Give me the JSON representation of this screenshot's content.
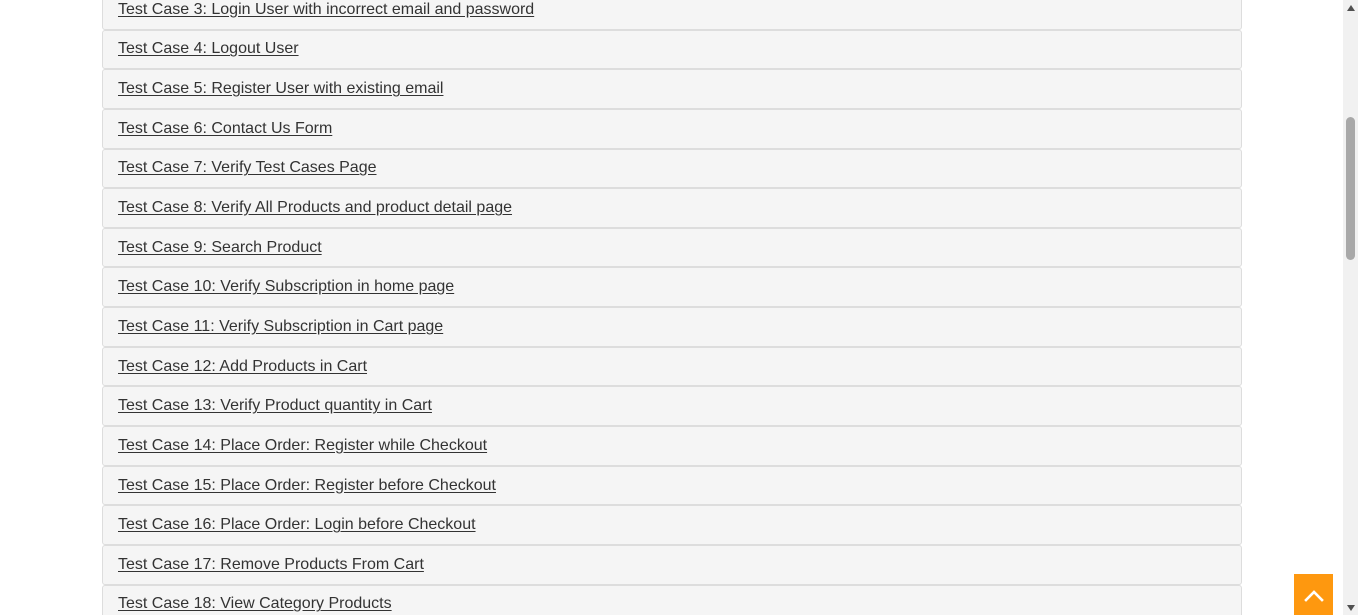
{
  "test_cases": [
    "Test Case 3: Login User with incorrect email and password",
    "Test Case 4: Logout User",
    "Test Case 5: Register User with existing email",
    "Test Case 6: Contact Us Form",
    "Test Case 7: Verify Test Cases Page",
    "Test Case 8: Verify All Products and product detail page",
    "Test Case 9: Search Product",
    "Test Case 10: Verify Subscription in home page",
    "Test Case 11: Verify Subscription in Cart page",
    "Test Case 12: Add Products in Cart",
    "Test Case 13: Verify Product quantity in Cart",
    "Test Case 14: Place Order: Register while Checkout",
    "Test Case 15: Place Order: Register before Checkout",
    "Test Case 16: Place Order: Login before Checkout",
    "Test Case 17: Remove Products From Cart",
    "Test Case 18: View Category Products"
  ],
  "colors": {
    "row_background": "#f5f5f5",
    "row_border": "#dddddd",
    "link_text": "#333333",
    "scroll_top_button": "#fe980f"
  },
  "icons": {
    "scroll_top": "chevron-up-icon",
    "scrollbar_up": "triangle-up-icon",
    "scrollbar_down": "triangle-down-icon"
  }
}
